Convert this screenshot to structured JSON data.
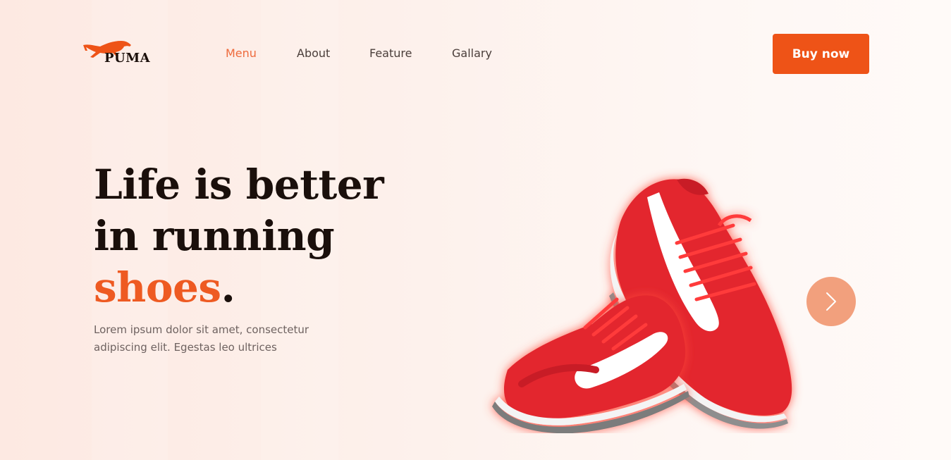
{
  "brand": {
    "name": "PUMA",
    "accent_color": "#ee5317"
  },
  "nav": {
    "items": [
      {
        "label": "Menu",
        "active": true
      },
      {
        "label": "About",
        "active": false
      },
      {
        "label": "Feature",
        "active": false
      },
      {
        "label": "Gallary",
        "active": false
      }
    ]
  },
  "header": {
    "cta_label": "Buy now"
  },
  "hero": {
    "line1": "Life is better",
    "line2": "in running",
    "accent_word": "shoes",
    "period": ".",
    "description": "Lorem ipsum dolor sit amet, consectetur adipiscing elit. Egestas leo ultrices"
  },
  "product": {
    "image": "red-running-shoes",
    "color": "#e3262f",
    "glow": "#ff5a4a"
  },
  "carousel": {
    "next_icon": "chevron-right-icon",
    "button_color": "#f2a07d"
  }
}
